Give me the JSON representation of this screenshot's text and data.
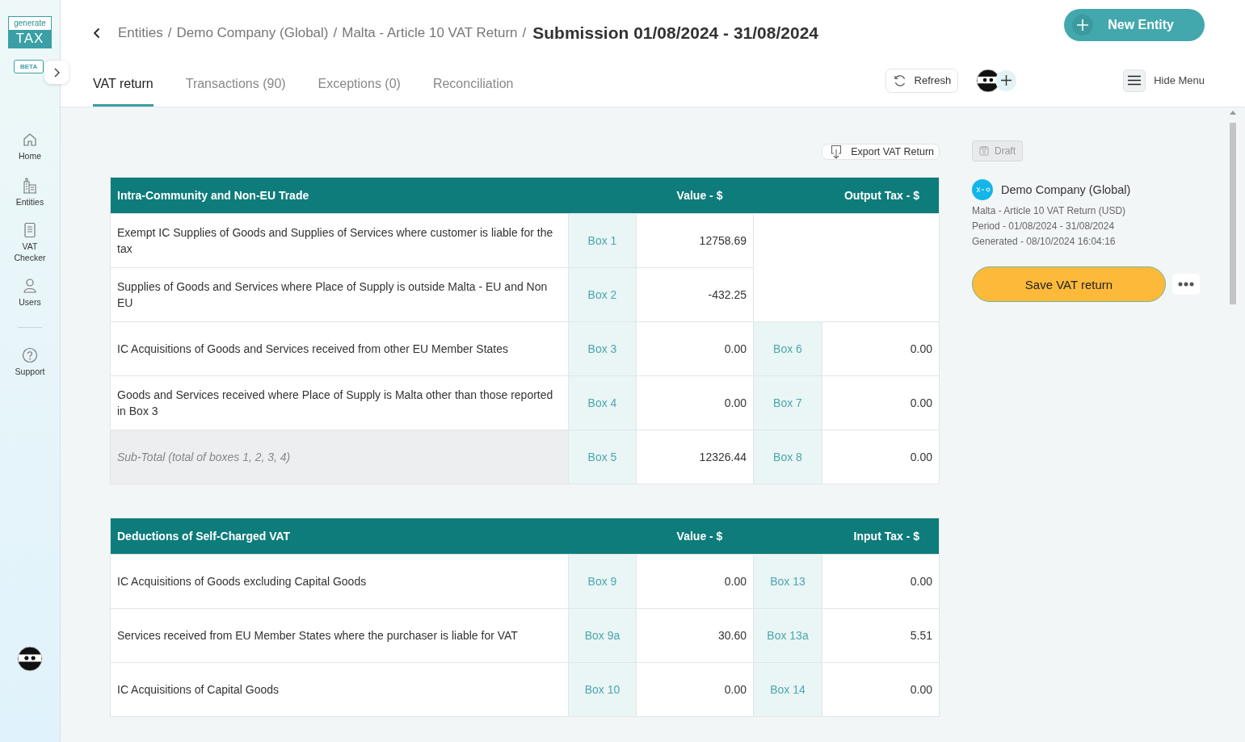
{
  "logo": {
    "top": "generate",
    "bottom": "TAX",
    "badge": "BETA"
  },
  "nav": [
    {
      "label": "Home"
    },
    {
      "label": "Entities"
    },
    {
      "label": "VAT Checker"
    },
    {
      "label": "Users"
    },
    {
      "label": "Support"
    }
  ],
  "breadcrumb": {
    "crumbs": [
      "Entities",
      "Demo Company (Global)",
      "Malta - Article 10 VAT Return"
    ],
    "separator": "/",
    "current": "Submission 01/08/2024 - 31/08/2024"
  },
  "new_entity_button": "New Entity",
  "tabs": [
    {
      "label": "VAT return",
      "selected": true
    },
    {
      "label": "Transactions (90)",
      "selected": false
    },
    {
      "label": "Exceptions (0)",
      "selected": false
    },
    {
      "label": "Reconciliation",
      "selected": false
    }
  ],
  "refresh_button": "Refresh",
  "hide_menu_button": "Hide Menu",
  "export_button": "Export VAT Return",
  "sections": [
    {
      "title": "Intra-Community and Non-EU Trade",
      "value_heading": "Value - $",
      "tax_heading": "Output Tax - $",
      "rows": [
        {
          "kind": "normal",
          "description": "Exempt IC Supplies of Goods and Supplies of Services where customer is liable for the tax",
          "box": "Box 1",
          "value": "12758.69"
        },
        {
          "kind": "normal",
          "description": "Supplies of Goods and Services where Place of Supply is outside Malta - EU and Non EU",
          "box": "Box 2",
          "value": "-432.25"
        },
        {
          "kind": "normal",
          "description": "IC Acquisitions of Goods and Services received from other EU Member States",
          "box": "Box 3",
          "value": "0.00",
          "tax_box": "Box 6",
          "tax": "0.00"
        },
        {
          "kind": "normal",
          "description": "Goods and Services received where Place of Supply is Malta other than those reported in Box 3",
          "box": "Box 4",
          "value": "0.00",
          "tax_box": "Box 7",
          "tax": "0.00"
        },
        {
          "kind": "subtotal",
          "description": "Sub-Total (total of boxes 1, 2, 3, 4)",
          "box": "Box 5",
          "value": "12326.44",
          "tax_box": "Box 8",
          "tax": "0.00"
        }
      ]
    },
    {
      "title": "Deductions of Self-Charged VAT",
      "value_heading": "Value - $",
      "tax_heading": "Input Tax - $",
      "rows": [
        {
          "kind": "normal",
          "description": "IC Acquisitions of Goods excluding Capital Goods",
          "box": "Box 9",
          "value": "0.00",
          "tax_box": "Box 13",
          "tax": "0.00"
        },
        {
          "kind": "normal",
          "description": "Services received from EU Member States where the purchaser is liable for VAT",
          "box": "Box 9a",
          "value": "30.60",
          "tax_box": "Box 13a",
          "tax": "5.51"
        },
        {
          "kind": "normal",
          "description": "IC Acquisitions of Capital Goods",
          "box": "Box 10",
          "value": "0.00",
          "tax_box": "Box 14",
          "tax": "0.00"
        }
      ]
    }
  ],
  "panel": {
    "status": "Draft",
    "company": "Demo Company (Global)",
    "details": [
      "Malta - Article 10 VAT Return (USD)",
      "Period - 01/08/2024 - 31/08/2024",
      "Generated - 08/10/2024 16:04:16"
    ],
    "save_button": "Save VAT return"
  }
}
